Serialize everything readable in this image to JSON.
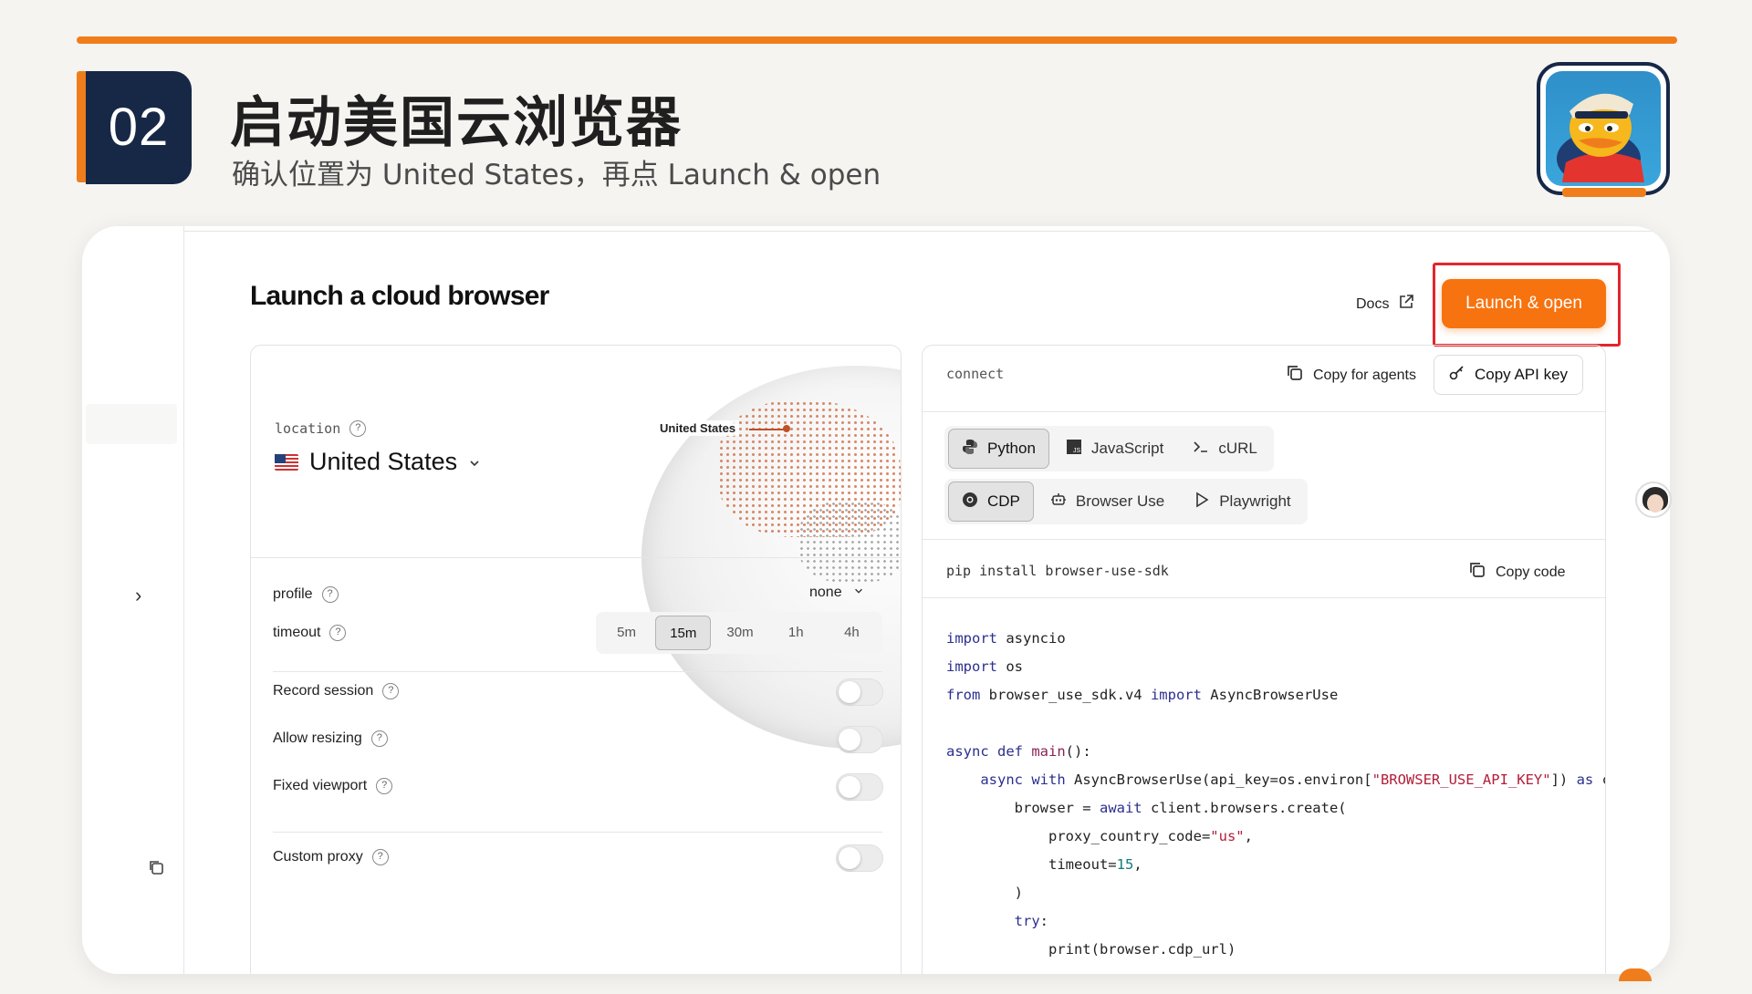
{
  "slide": {
    "step_number": "02",
    "title": "启动美国云浏览器",
    "subtitle": "确认位置为 United States，再点 Launch & open"
  },
  "app": {
    "heading": "Launch a cloud browser",
    "docs_label": "Docs",
    "launch_label": "Launch & open"
  },
  "location": {
    "label": "location",
    "value": "United States",
    "globe_tag": "United States"
  },
  "settings": {
    "profile_label": "profile",
    "profile_value": "none",
    "timeout_label": "timeout",
    "timeout_options": [
      "5m",
      "15m",
      "30m",
      "1h",
      "4h"
    ],
    "timeout_selected": "15m",
    "toggles": [
      {
        "label": "Record session",
        "on": false
      },
      {
        "label": "Allow resizing",
        "on": false
      },
      {
        "label": "Fixed viewport",
        "on": false
      },
      {
        "label": "Custom proxy",
        "on": false
      }
    ]
  },
  "connect": {
    "label": "connect",
    "copy_agents_label": "Copy for agents",
    "copy_api_label": "Copy API key",
    "languages": [
      "Python",
      "JavaScript",
      "cURL"
    ],
    "language_selected": "Python",
    "modes": [
      "CDP",
      "Browser Use",
      "Playwright"
    ],
    "mode_selected": "CDP",
    "install_command": "pip install browser-use-sdk",
    "copy_code_label": "Copy code"
  },
  "colors": {
    "accent": "#f07d1b",
    "launch_button": "#f7730f",
    "highlight_box": "#e3252d",
    "step_box": "#172847"
  },
  "icons": [
    "chevron-right-icon",
    "copy-icon",
    "external-link-icon",
    "key-icon",
    "python-icon",
    "javascript-icon",
    "terminal-icon",
    "chrome-icon",
    "robot-icon",
    "play-icon",
    "help-icon",
    "chevron-down-icon"
  ]
}
